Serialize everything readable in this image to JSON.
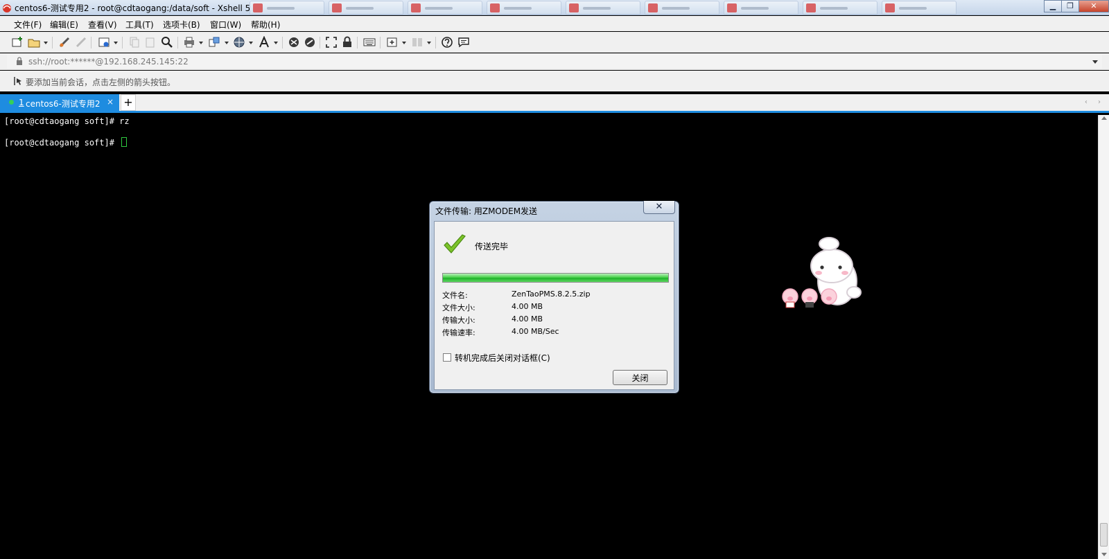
{
  "window": {
    "title": "centos6-测试专用2 - root@cdtaogang:/data/soft - Xshell 5",
    "controls": {
      "minimize": "▁",
      "restore": "❐",
      "close": "✕"
    }
  },
  "menu": [
    "文件(F)",
    "编辑(E)",
    "查看(V)",
    "工具(T)",
    "选项卡(B)",
    "窗口(W)",
    "帮助(H)"
  ],
  "address": {
    "value": "ssh://root:******@192.168.245.145:22"
  },
  "hint": {
    "text": "要添加当前会话，点击左侧的箭头按钮。"
  },
  "tabs": {
    "active": {
      "number": "1",
      "label": "centos6-测试专用2",
      "close": "×"
    },
    "add_label": "+",
    "nav": "‹ ›"
  },
  "terminal": {
    "lines": [
      "[root@cdtaogang soft]# rz",
      "[root@cdtaogang soft]# "
    ]
  },
  "dialog": {
    "title": "文件传输: 用ZMODEM发送",
    "close_x": "✕",
    "status": "传送完毕",
    "progress_fraction": 1.0,
    "info": [
      {
        "label": "文件名:",
        "value": "ZenTaoPMS.8.2.5.zip"
      },
      {
        "label": "文件大小:",
        "value": "4.00 MB"
      },
      {
        "label": "传输大小:",
        "value": "4.00 MB"
      },
      {
        "label": "传输速率:",
        "value": "4.00 MB/Sec"
      }
    ],
    "option_label": "转机完成后关闭对话框(C)",
    "option_checked": false,
    "close_button": "关闭"
  },
  "colors": {
    "tab_accent": "#1e8ce0",
    "progress_green": "#1fb22a",
    "cursor_green": "#2ecc40"
  },
  "icons": [
    "new-session-icon",
    "open-folder-icon",
    "reconnect-icon",
    "disconnect-icon",
    "properties-icon",
    "copy-icon",
    "paste-icon",
    "find-icon",
    "print-icon",
    "transfer-icon",
    "globe-icon",
    "font-icon",
    "xftp-icon",
    "xmanager-icon",
    "fullscreen-icon",
    "lock-icon",
    "keyboard-icon",
    "add-icon",
    "layout-icon",
    "help-icon",
    "chat-icon"
  ]
}
